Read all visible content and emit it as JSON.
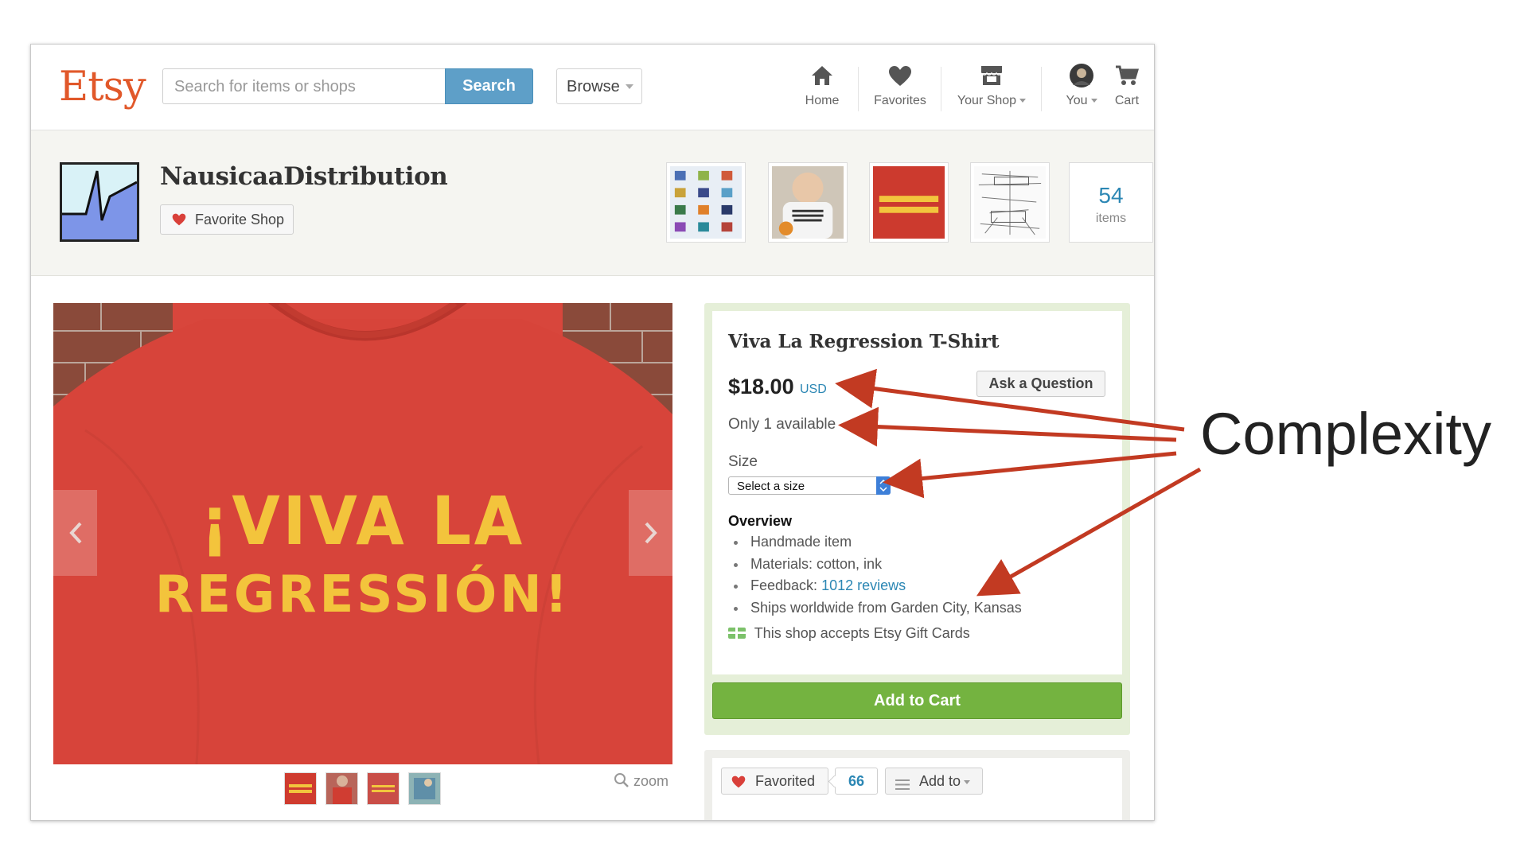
{
  "header": {
    "logo": "Etsy",
    "search_placeholder": "Search for items or shops",
    "search_button": "Search",
    "browse": "Browse",
    "nav": [
      {
        "label": "Home",
        "icon": "home-icon"
      },
      {
        "label": "Favorites",
        "icon": "heart-icon"
      },
      {
        "label": "Your Shop",
        "icon": "shop-icon"
      },
      {
        "label": "You",
        "icon": "avatar"
      },
      {
        "label": "Cart",
        "icon": "cart-icon"
      }
    ]
  },
  "shop": {
    "name": "NausicaaDistribution",
    "favorite_button": "Favorite Shop",
    "thumbnail_labels": [
      "",
      "",
      "",
      ""
    ],
    "items_count": "54",
    "items_label": "items"
  },
  "product_image": {
    "shirt_text_line1": "¡VIVA LA",
    "shirt_text_line2": "REGRESSIÓN!",
    "zoom_label": "zoom"
  },
  "listing": {
    "title": "Viva La Regression T-Shirt",
    "price": "$18.00",
    "currency": "USD",
    "ask_button": "Ask a Question",
    "availability": "Only 1 available",
    "size_label": "Size",
    "size_select_value": "Select a size",
    "overview_heading": "Overview",
    "overview": {
      "item1": "Handmade item",
      "item2": "Materials: cotton, ink",
      "feedback_prefix": "Feedback: ",
      "feedback_link": "1012 reviews",
      "item4": "Ships worldwide from Garden City, Kansas"
    },
    "gift_cards": "This shop accepts Etsy Gift Cards",
    "add_to_cart": "Add to Cart"
  },
  "social": {
    "favorited": "Favorited",
    "favorite_count": "66",
    "add_to": "Add to"
  },
  "annotation": {
    "label": "Complexity",
    "arrow_color": "#c23a22"
  },
  "colors": {
    "etsy_orange": "#e1582a",
    "link_blue": "#2c87b4",
    "cart_green": "#74b340",
    "search_blue": "#5e9fc8"
  }
}
